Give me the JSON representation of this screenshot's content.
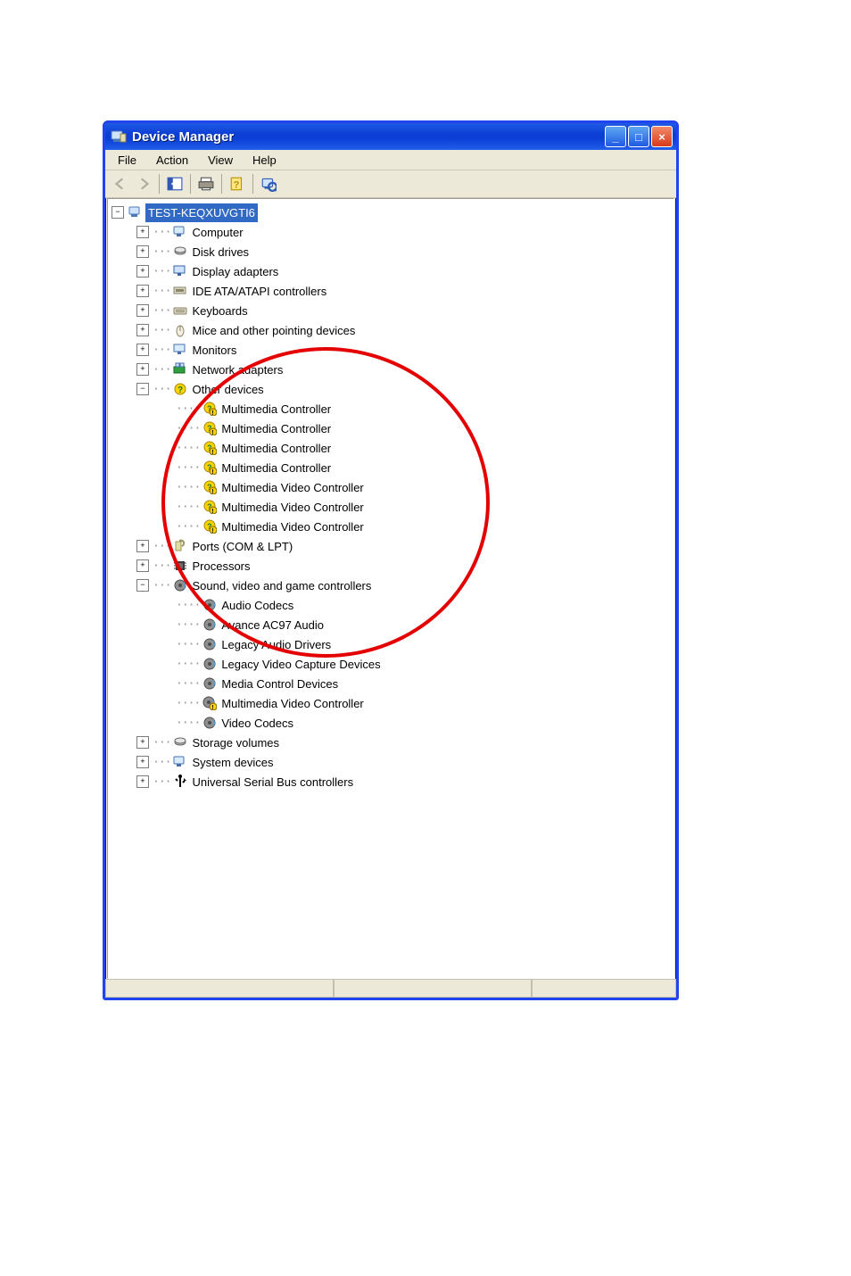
{
  "window": {
    "title": "Device Manager",
    "buttons": {
      "min": "_",
      "max": "□",
      "close": "×"
    }
  },
  "menu": {
    "file": "File",
    "action": "Action",
    "view": "View",
    "help": "Help"
  },
  "toolbar": {
    "back": "Back",
    "forward": "Forward",
    "show_hide": "Show/Hide console tree",
    "print": "Print",
    "help": "Help",
    "scan": "Scan for hardware changes"
  },
  "tree": {
    "root": "TEST-KEQXUVGTI6",
    "nodes": [
      {
        "label": "Computer",
        "icon": "computer",
        "expand": "+"
      },
      {
        "label": "Disk drives",
        "icon": "disk",
        "expand": "+"
      },
      {
        "label": "Display adapters",
        "icon": "display",
        "expand": "+"
      },
      {
        "label": "IDE ATA/ATAPI controllers",
        "icon": "ide",
        "expand": "+"
      },
      {
        "label": "Keyboards",
        "icon": "keyboard",
        "expand": "+"
      },
      {
        "label": "Mice and other pointing devices",
        "icon": "mouse",
        "expand": "+"
      },
      {
        "label": "Monitors",
        "icon": "monitor",
        "expand": "+"
      },
      {
        "label": "Network adapters",
        "icon": "network",
        "expand": "+"
      },
      {
        "label": "Other devices",
        "icon": "other",
        "expand": "-",
        "children": [
          {
            "label": "Multimedia Controller",
            "icon": "warn"
          },
          {
            "label": "Multimedia Controller",
            "icon": "warn"
          },
          {
            "label": "Multimedia Controller",
            "icon": "warn"
          },
          {
            "label": "Multimedia Controller",
            "icon": "warn"
          },
          {
            "label": "Multimedia Video Controller",
            "icon": "warn"
          },
          {
            "label": "Multimedia Video Controller",
            "icon": "warn"
          },
          {
            "label": "Multimedia Video Controller",
            "icon": "warn"
          }
        ]
      },
      {
        "label": "Ports (COM & LPT)",
        "icon": "ports",
        "expand": "+"
      },
      {
        "label": "Processors",
        "icon": "cpu",
        "expand": "+"
      },
      {
        "label": "Sound, video and game controllers",
        "icon": "sound",
        "expand": "-",
        "children": [
          {
            "label": "Audio Codecs",
            "icon": "sound"
          },
          {
            "label": "Avance AC97 Audio",
            "icon": "sound"
          },
          {
            "label": "Legacy Audio Drivers",
            "icon": "sound"
          },
          {
            "label": "Legacy Video Capture Devices",
            "icon": "sound"
          },
          {
            "label": "Media Control Devices",
            "icon": "sound"
          },
          {
            "label": "Multimedia Video Controller",
            "icon": "sound_warn"
          },
          {
            "label": "Video Codecs",
            "icon": "sound"
          }
        ]
      },
      {
        "label": "Storage volumes",
        "icon": "disk",
        "expand": "+"
      },
      {
        "label": "System devices",
        "icon": "system",
        "expand": "+"
      },
      {
        "label": "Universal Serial Bus controllers",
        "icon": "usb",
        "expand": "+"
      }
    ]
  },
  "annotation": {
    "shape": "red-circle",
    "meaning": "highlighted unknown devices"
  }
}
